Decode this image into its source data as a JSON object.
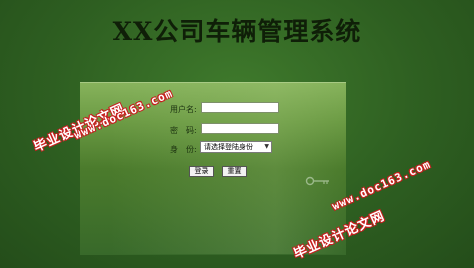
{
  "app": {
    "title": "XX公司车辆管理系统"
  },
  "login": {
    "username_label": "用户名:",
    "password_label": "密　码:",
    "role_label": "身　份:",
    "username_value": "",
    "password_value": "",
    "role_selected": "请选择登陆身份",
    "login_button": "登录",
    "reset_button": "重置"
  },
  "watermarks": [
    {
      "text_cn": "毕业设计论文网",
      "text_url": "www.doc163.com"
    },
    {
      "text_cn": "毕业设计论文网",
      "text_url": "www.doc163.com"
    }
  ],
  "colors": {
    "background": "#2f5f22",
    "panel_top": "#86b25b",
    "panel_bottom": "#38692a",
    "title": "#0f1f08",
    "watermark_outline": "#c81e1e"
  },
  "icons": {
    "key": "key-icon",
    "dropdown": "chevron-down-icon"
  }
}
